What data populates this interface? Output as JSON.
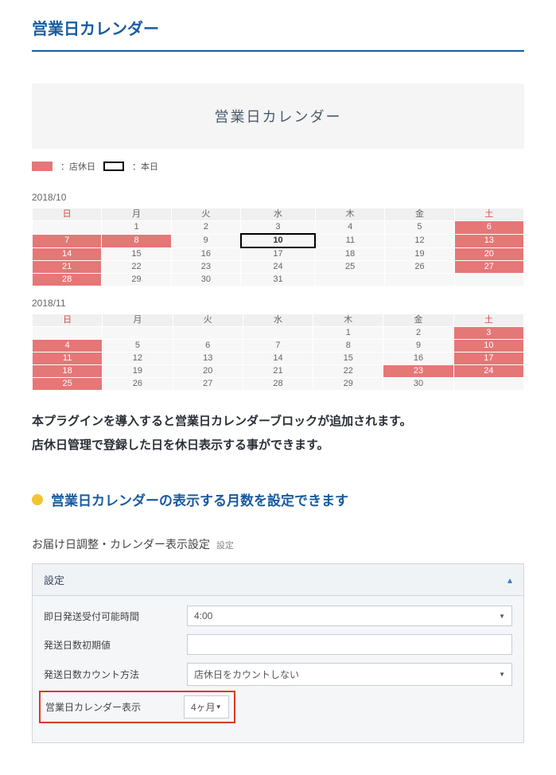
{
  "pageTitle": "営業日カレンダー",
  "bannerTitle": "営業日カレンダー",
  "legend": {
    "holidayLabel": "：店休日",
    "todayLabel": "：本日"
  },
  "weekdays": [
    "日",
    "月",
    "火",
    "水",
    "木",
    "金",
    "土"
  ],
  "months": [
    {
      "label": "2018/10",
      "startWeekday": 1,
      "days": 31,
      "today": 10,
      "holidays": [
        6,
        7,
        8,
        13,
        14,
        20,
        21,
        27,
        28
      ]
    },
    {
      "label": "2018/11",
      "startWeekday": 4,
      "days": 30,
      "today": null,
      "holidays": [
        3,
        4,
        10,
        11,
        17,
        18,
        23,
        24,
        25
      ]
    }
  ],
  "description": {
    "line1": "本プラグインを導入すると営業日カレンダーブロックが追加されます。",
    "line2": "店休日管理で登録した日を休日表示する事ができます。"
  },
  "sectionHeading": "営業日カレンダーの表示する月数を設定できます",
  "settings": {
    "title": "お届け日調整・カレンダー表示設定",
    "titleSuffix": "設定",
    "panelHead": "設定",
    "rows": {
      "cutoffTime": {
        "label": "即日発送受付可能時間",
        "value": "4:00",
        "type": "select"
      },
      "defaultShipDays": {
        "label": "発送日数初期値",
        "value": "",
        "type": "input"
      },
      "shipCountMethod": {
        "label": "発送日数カウント方法",
        "value": "店休日をカウントしない",
        "type": "select"
      },
      "calendarDisplay": {
        "label": "営業日カレンダー表示",
        "value": "4ヶ月",
        "type": "select",
        "highlight": true
      }
    }
  }
}
